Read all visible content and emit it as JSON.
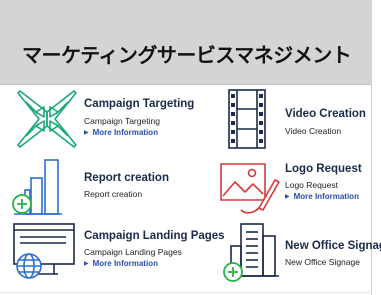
{
  "header": {
    "title": "マーケティングサービスマネジメント"
  },
  "tiles": [
    {
      "title": "Campaign Targeting",
      "subtitle": "Campaign Targeting",
      "more": "More Information",
      "icon": "targeting-icon"
    },
    {
      "title": "Video Creation",
      "subtitle": "Video Creation",
      "icon": "film-strip-icon"
    },
    {
      "title": "Report creation",
      "subtitle": "Report creation",
      "icon": "bar-chart-add-icon"
    },
    {
      "title": "Logo Request",
      "subtitle": "Logo Request",
      "more": "More Information",
      "icon": "image-edit-icon"
    },
    {
      "title": "Campaign Landing Pages",
      "subtitle": "Campaign Landing Pages",
      "more": "More Information",
      "icon": "monitor-globe-icon"
    },
    {
      "title": "New Office Signage",
      "subtitle": "New Office Signage",
      "icon": "building-add-icon"
    }
  ],
  "colors": {
    "teal": "#1aa87a",
    "blue": "#2a6fd0",
    "navy": "#1a2a4a",
    "red": "#d33a3a",
    "green": "#2bb04a"
  }
}
